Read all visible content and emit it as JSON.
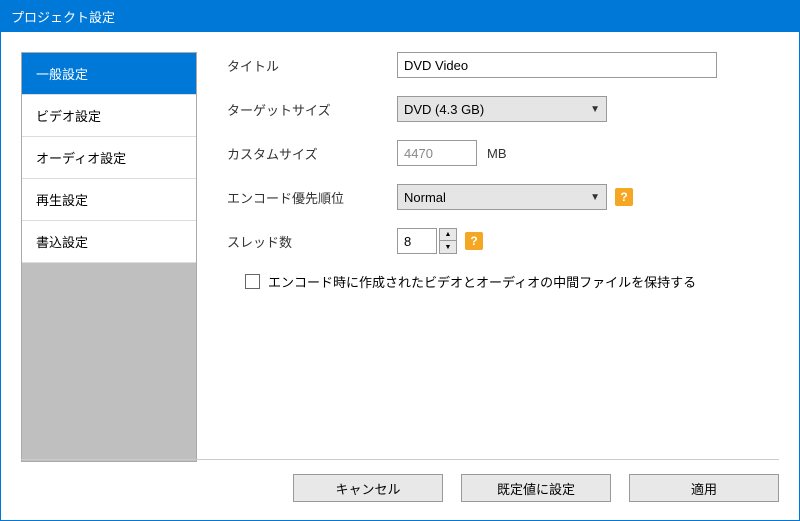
{
  "window": {
    "title": "プロジェクト設定"
  },
  "sidebar": {
    "items": [
      {
        "label": "一般設定",
        "active": true
      },
      {
        "label": "ビデオ設定",
        "active": false
      },
      {
        "label": "オーディオ設定",
        "active": false
      },
      {
        "label": "再生設定",
        "active": false
      },
      {
        "label": "書込設定",
        "active": false
      }
    ]
  },
  "fields": {
    "title_label": "タイトル",
    "title_value": "DVD Video",
    "target_size_label": "ターゲットサイズ",
    "target_size_value": "DVD (4.3 GB)",
    "custom_size_label": "カスタムサイズ",
    "custom_size_value": "4470",
    "custom_size_unit": "MB",
    "encode_priority_label": "エンコード優先順位",
    "encode_priority_value": "Normal",
    "threads_label": "スレッド数",
    "threads_value": "8",
    "keep_intermediate_label": "エンコード時に作成されたビデオとオーディオの中間ファイルを保持する"
  },
  "buttons": {
    "cancel": "キャンセル",
    "reset": "既定値に設定",
    "apply": "適用"
  },
  "help": "?"
}
